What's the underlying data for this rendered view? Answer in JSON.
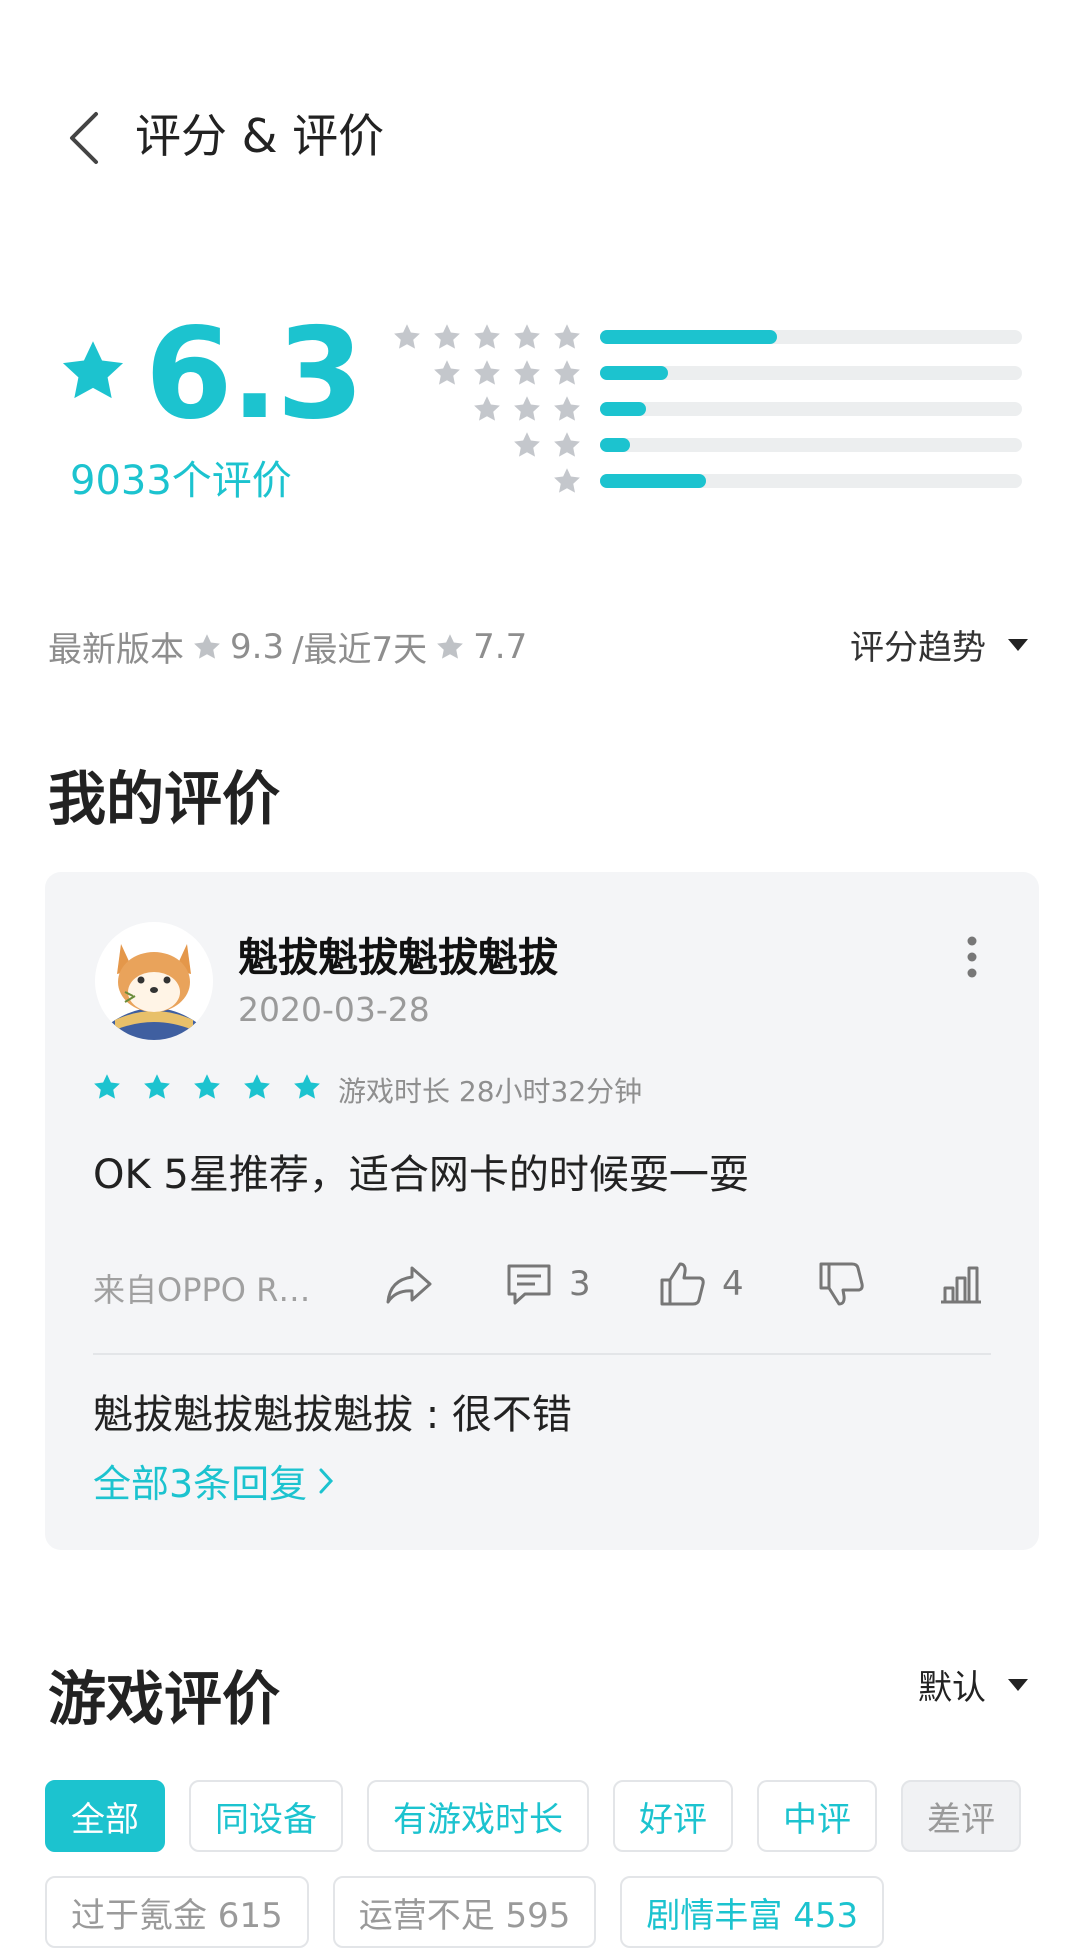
{
  "header": {
    "title": "评分 & 评价"
  },
  "rating": {
    "score": "6.3",
    "count_text": "9033个评价",
    "distribution": [
      {
        "stars": 5,
        "fraction": 0.42
      },
      {
        "stars": 4,
        "fraction": 0.16
      },
      {
        "stars": 3,
        "fraction": 0.11
      },
      {
        "stars": 2,
        "fraction": 0.07
      },
      {
        "stars": 1,
        "fraction": 0.25
      }
    ]
  },
  "version_line": {
    "latest_label": "最新版本",
    "latest_score": "9.3",
    "recent_label": "/最近7天",
    "recent_score": "7.7",
    "trend_label": "评分趋势"
  },
  "my_review": {
    "section_title": "我的评价",
    "user_name": "魁拔魁拔魁拔魁拔",
    "date": "2020-03-28",
    "stars": 5,
    "playtime": "游戏时长 28小时32分钟",
    "text": "OK 5星推荐，适合网卡的时候耍一耍",
    "device": "来自OPPO R9...",
    "comment_count": "3",
    "like_count": "4",
    "reply_text": "魁拔魁拔魁拔魁拔 : 很不错",
    "all_replies_label": "全部3条回复"
  },
  "game_reviews": {
    "section_title": "游戏评价",
    "sort_label": "默认",
    "filters": [
      "全部",
      "同设备",
      "有游戏时长",
      "好评",
      "中评",
      "差评"
    ],
    "tags": [
      "过于氪金 615",
      "运营不足 595",
      "剧情丰富 453"
    ]
  },
  "colors": {
    "accent": "#1cc3cf",
    "star_gray": "#c4c7cc",
    "bar_bg": "#eceeef"
  }
}
